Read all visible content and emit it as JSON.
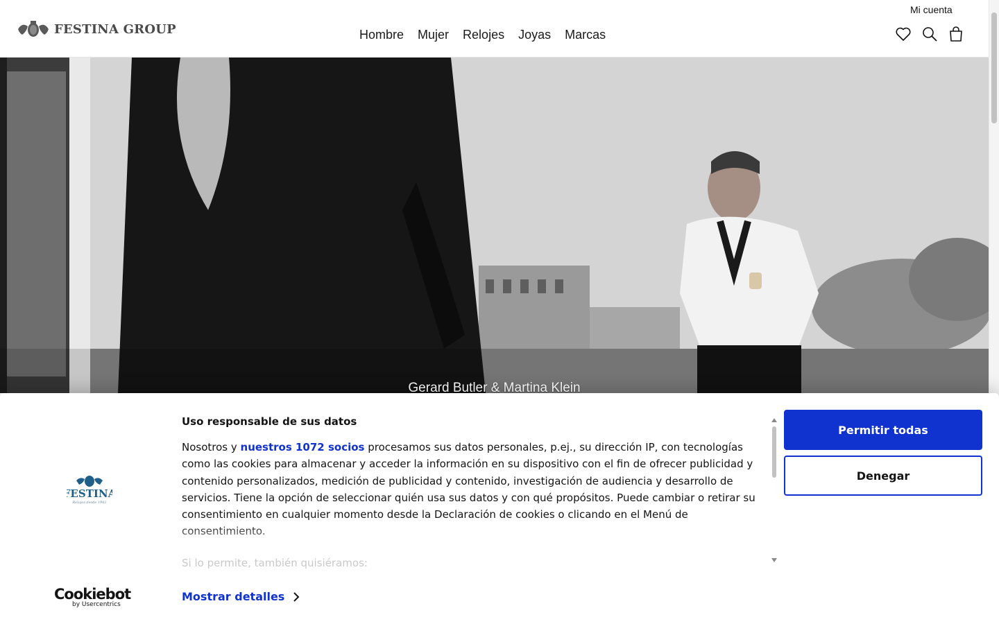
{
  "header": {
    "brand": "FESTINA GROUP",
    "account_label": "Mi cuenta",
    "nav": [
      "Hombre",
      "Mujer",
      "Relojes",
      "Joyas",
      "Marcas"
    ],
    "icons": [
      "heart-icon",
      "search-icon",
      "shopping-bag-icon"
    ]
  },
  "hero": {
    "caption": "Gerard Butler & Martina Klein"
  },
  "cookie_banner": {
    "logo_brand": "FESTINA",
    "logo_tagline": "Relojes desde 1902",
    "title": "Uso responsable de sus datos",
    "text_prefix": "Nosotros y ",
    "partners_link": "nuestros 1072 socios",
    "text_suffix": " procesamos sus datos personales, p.ej., su dirección IP, con tecnologías como las cookies para almacenar y acceder la información en su dispositivo con el fin de ofrecer publicidad y contenido personalizados, medición de publicidad y contenido, investigación de audiencia y desarrollo de servicios. Tiene la opción de seleccionar quién usa sus datos y con qué propósitos. Puede cambiar o retirar su consentimiento en cualquier momento desde la Declaración de cookies o clicando en el Menú de consentimiento.",
    "more_text": "Si lo permite, también quisiéramos:",
    "details_label": "Mostrar detalles",
    "allow_label": "Permitir todas",
    "deny_label": "Denegar",
    "provider_brand": "Cookiebot",
    "provider_by": "by Usercentrics",
    "accent_color": "#1032cf"
  }
}
